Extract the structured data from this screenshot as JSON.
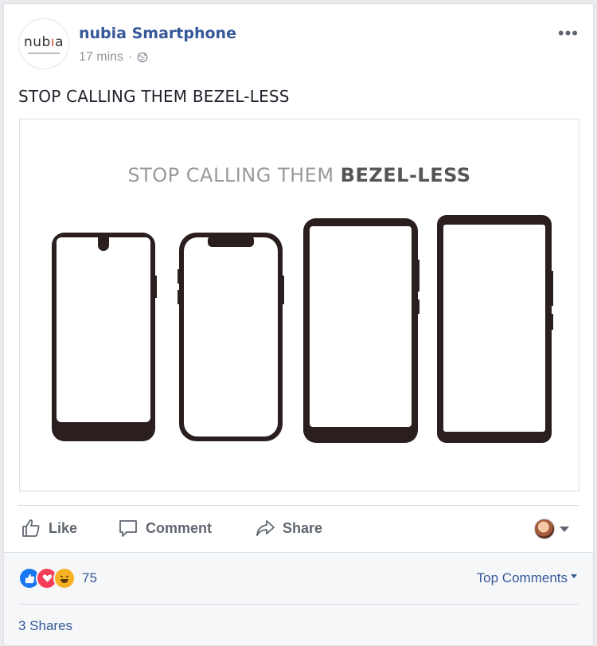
{
  "post": {
    "page_name": "nubia Smartphone",
    "timestamp": "17 mins",
    "separator": "·",
    "privacy_icon": "globe-icon",
    "more_icon": "•••",
    "text": "STOP CALLING THEM BEZEL-LESS",
    "avatar": {
      "logo_text": "nubia",
      "accent_color": "#e3462c"
    }
  },
  "media": {
    "headline_light": "STOP CALLING THEM ",
    "headline_bold": "BEZEL-LESS",
    "phone_styles": [
      "notch-drop",
      "notch-wide",
      "small-bezels",
      "minimal-bezels"
    ]
  },
  "actions": {
    "like": "Like",
    "comment": "Comment",
    "share": "Share"
  },
  "footer": {
    "reactions": [
      "like",
      "love",
      "haha"
    ],
    "reaction_count": "75",
    "top_comments": "Top Comments",
    "shares": "3 Shares"
  },
  "colors": {
    "link": "#365899",
    "meta": "#90949c",
    "action": "#606770"
  }
}
